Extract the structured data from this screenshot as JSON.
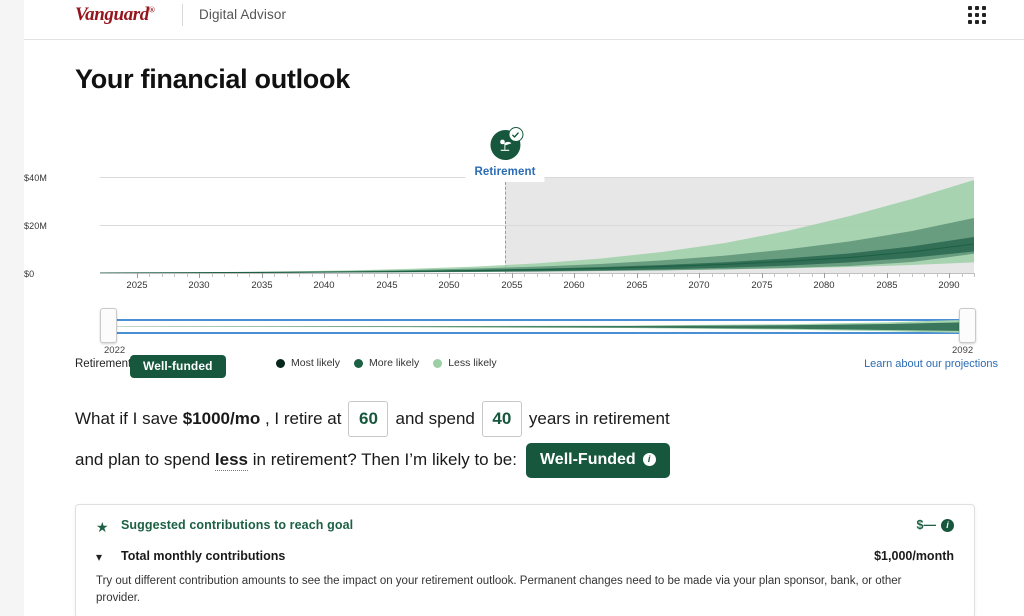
{
  "header": {
    "brand": "Vanguard",
    "brand_registered": "®",
    "product": "Digital Advisor",
    "apps_icon": "grid-apps-icon"
  },
  "page_title": "Your financial outlook",
  "chart": {
    "marker": {
      "label": "Retirement",
      "badge_icon": "beach-retirement-icon",
      "check_icon": "check-icon"
    },
    "legend": [
      {
        "label": "Most likely",
        "color": "#08271c"
      },
      {
        "label": "More likely",
        "color": "#1d6145"
      },
      {
        "label": "Less likely",
        "color": "#9ccfa6"
      }
    ],
    "status_label": "Retirement:",
    "status_value": "Well-funded",
    "learn_link": "Learn about our projections",
    "range": {
      "start_year": "2022",
      "end_year": "2092"
    }
  },
  "chart_data": {
    "type": "area",
    "title": "Your financial outlook",
    "xlabel": "",
    "ylabel": "",
    "xlim": [
      2022,
      2092
    ],
    "ylim": [
      0,
      48000000
    ],
    "yticks": [
      0,
      20000000,
      40000000
    ],
    "ytick_labels": [
      "$0",
      "$20M",
      "$40M"
    ],
    "xticks": [
      2025,
      2030,
      2035,
      2040,
      2045,
      2050,
      2055,
      2060,
      2065,
      2070,
      2075,
      2080,
      2085,
      2090
    ],
    "xtick_labels": [
      "2025",
      "2030",
      "2035",
      "2040",
      "2045",
      "2050",
      "2055",
      "2060",
      "2065",
      "2070",
      "2075",
      "2080",
      "2085",
      "2090"
    ],
    "grid": true,
    "legend_position": "below-chart",
    "retirement_year": 2052,
    "shaded_region": [
      2052,
      2092
    ],
    "x": [
      2022,
      2027,
      2032,
      2037,
      2042,
      2047,
      2052,
      2057,
      2062,
      2067,
      2072,
      2077,
      2082,
      2087,
      2092
    ],
    "series": [
      {
        "name": "Less likely",
        "role": "outer-band-upper",
        "color": "#9ccfa6",
        "values": [
          0,
          180000,
          420000,
          780000,
          1300000,
          2100000,
          3200000,
          4800000,
          7200000,
          10500000,
          15000000,
          21000000,
          28500000,
          37000000,
          46500000
        ]
      },
      {
        "name": "More likely",
        "role": "inner-band-upper",
        "color": "#4f8a6d",
        "values": [
          0,
          140000,
          320000,
          600000,
          980000,
          1500000,
          2250000,
          3200000,
          4500000,
          6300000,
          8700000,
          11800000,
          15800000,
          21000000,
          27500000
        ]
      },
      {
        "name": "Most likely",
        "role": "median",
        "color": "#2e6b52",
        "values": [
          0,
          110000,
          250000,
          450000,
          720000,
          1080000,
          1550000,
          2150000,
          2950000,
          4000000,
          5400000,
          7200000,
          9600000,
          12800000,
          17000000
        ]
      },
      {
        "name": "More likely",
        "role": "inner-band-lower",
        "color": "#4f8a6d",
        "values": [
          0,
          90000,
          200000,
          350000,
          550000,
          800000,
          1120000,
          1500000,
          2000000,
          2650000,
          3450000,
          4500000,
          5800000,
          7500000,
          9600000
        ]
      },
      {
        "name": "Less likely",
        "role": "outer-band-lower",
        "color": "#9ccfa6",
        "values": [
          0,
          70000,
          150000,
          250000,
          380000,
          540000,
          740000,
          960000,
          1250000,
          1600000,
          2050000,
          2600000,
          3300000,
          4200000,
          5300000
        ]
      }
    ]
  },
  "whatif": {
    "part1": "What if I save",
    "savings": "$1000/mo",
    "part2": ", I retire at",
    "retire_age": "60",
    "part3": "and spend",
    "years_retirement": "40",
    "part4": "years in retirement",
    "part5": "and plan to spend",
    "spend_level": "less",
    "part6": "in retirement? Then I’m likely to be:",
    "outcome": "Well-Funded",
    "outcome_info_icon": "info-icon"
  },
  "card": {
    "star_icon": "star-icon",
    "title": "Suggested contributions to reach goal",
    "amount": "$—",
    "info_icon": "info-icon",
    "chevron_icon": "chevron-down-icon",
    "subtitle": "Total monthly contributions",
    "value": "$1,000/month",
    "description": "Try out different contribution amounts to see the impact on your retirement outlook. Permanent changes need to be made via your plan sponsor, bank, or other provider."
  }
}
